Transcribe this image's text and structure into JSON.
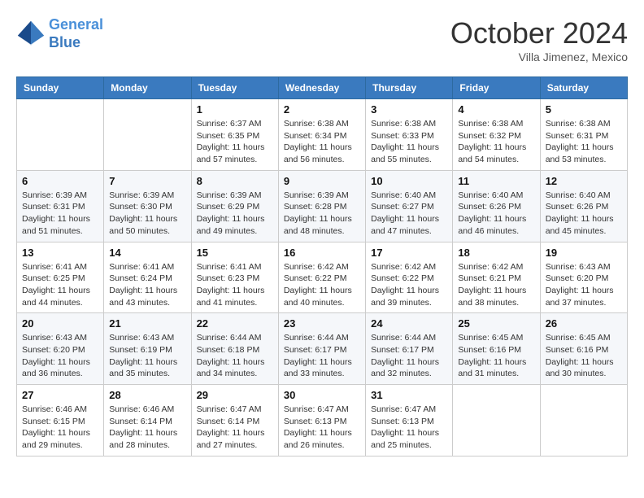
{
  "header": {
    "logo_line1": "General",
    "logo_line2": "Blue",
    "month": "October 2024",
    "location": "Villa Jimenez, Mexico"
  },
  "days_of_week": [
    "Sunday",
    "Monday",
    "Tuesday",
    "Wednesday",
    "Thursday",
    "Friday",
    "Saturday"
  ],
  "weeks": [
    [
      {
        "day": "",
        "content": ""
      },
      {
        "day": "",
        "content": ""
      },
      {
        "day": "1",
        "content": "Sunrise: 6:37 AM\nSunset: 6:35 PM\nDaylight: 11 hours and 57 minutes."
      },
      {
        "day": "2",
        "content": "Sunrise: 6:38 AM\nSunset: 6:34 PM\nDaylight: 11 hours and 56 minutes."
      },
      {
        "day": "3",
        "content": "Sunrise: 6:38 AM\nSunset: 6:33 PM\nDaylight: 11 hours and 55 minutes."
      },
      {
        "day": "4",
        "content": "Sunrise: 6:38 AM\nSunset: 6:32 PM\nDaylight: 11 hours and 54 minutes."
      },
      {
        "day": "5",
        "content": "Sunrise: 6:38 AM\nSunset: 6:31 PM\nDaylight: 11 hours and 53 minutes."
      }
    ],
    [
      {
        "day": "6",
        "content": "Sunrise: 6:39 AM\nSunset: 6:31 PM\nDaylight: 11 hours and 51 minutes."
      },
      {
        "day": "7",
        "content": "Sunrise: 6:39 AM\nSunset: 6:30 PM\nDaylight: 11 hours and 50 minutes."
      },
      {
        "day": "8",
        "content": "Sunrise: 6:39 AM\nSunset: 6:29 PM\nDaylight: 11 hours and 49 minutes."
      },
      {
        "day": "9",
        "content": "Sunrise: 6:39 AM\nSunset: 6:28 PM\nDaylight: 11 hours and 48 minutes."
      },
      {
        "day": "10",
        "content": "Sunrise: 6:40 AM\nSunset: 6:27 PM\nDaylight: 11 hours and 47 minutes."
      },
      {
        "day": "11",
        "content": "Sunrise: 6:40 AM\nSunset: 6:26 PM\nDaylight: 11 hours and 46 minutes."
      },
      {
        "day": "12",
        "content": "Sunrise: 6:40 AM\nSunset: 6:26 PM\nDaylight: 11 hours and 45 minutes."
      }
    ],
    [
      {
        "day": "13",
        "content": "Sunrise: 6:41 AM\nSunset: 6:25 PM\nDaylight: 11 hours and 44 minutes."
      },
      {
        "day": "14",
        "content": "Sunrise: 6:41 AM\nSunset: 6:24 PM\nDaylight: 11 hours and 43 minutes."
      },
      {
        "day": "15",
        "content": "Sunrise: 6:41 AM\nSunset: 6:23 PM\nDaylight: 11 hours and 41 minutes."
      },
      {
        "day": "16",
        "content": "Sunrise: 6:42 AM\nSunset: 6:22 PM\nDaylight: 11 hours and 40 minutes."
      },
      {
        "day": "17",
        "content": "Sunrise: 6:42 AM\nSunset: 6:22 PM\nDaylight: 11 hours and 39 minutes."
      },
      {
        "day": "18",
        "content": "Sunrise: 6:42 AM\nSunset: 6:21 PM\nDaylight: 11 hours and 38 minutes."
      },
      {
        "day": "19",
        "content": "Sunrise: 6:43 AM\nSunset: 6:20 PM\nDaylight: 11 hours and 37 minutes."
      }
    ],
    [
      {
        "day": "20",
        "content": "Sunrise: 6:43 AM\nSunset: 6:20 PM\nDaylight: 11 hours and 36 minutes."
      },
      {
        "day": "21",
        "content": "Sunrise: 6:43 AM\nSunset: 6:19 PM\nDaylight: 11 hours and 35 minutes."
      },
      {
        "day": "22",
        "content": "Sunrise: 6:44 AM\nSunset: 6:18 PM\nDaylight: 11 hours and 34 minutes."
      },
      {
        "day": "23",
        "content": "Sunrise: 6:44 AM\nSunset: 6:17 PM\nDaylight: 11 hours and 33 minutes."
      },
      {
        "day": "24",
        "content": "Sunrise: 6:44 AM\nSunset: 6:17 PM\nDaylight: 11 hours and 32 minutes."
      },
      {
        "day": "25",
        "content": "Sunrise: 6:45 AM\nSunset: 6:16 PM\nDaylight: 11 hours and 31 minutes."
      },
      {
        "day": "26",
        "content": "Sunrise: 6:45 AM\nSunset: 6:16 PM\nDaylight: 11 hours and 30 minutes."
      }
    ],
    [
      {
        "day": "27",
        "content": "Sunrise: 6:46 AM\nSunset: 6:15 PM\nDaylight: 11 hours and 29 minutes."
      },
      {
        "day": "28",
        "content": "Sunrise: 6:46 AM\nSunset: 6:14 PM\nDaylight: 11 hours and 28 minutes."
      },
      {
        "day": "29",
        "content": "Sunrise: 6:47 AM\nSunset: 6:14 PM\nDaylight: 11 hours and 27 minutes."
      },
      {
        "day": "30",
        "content": "Sunrise: 6:47 AM\nSunset: 6:13 PM\nDaylight: 11 hours and 26 minutes."
      },
      {
        "day": "31",
        "content": "Sunrise: 6:47 AM\nSunset: 6:13 PM\nDaylight: 11 hours and 25 minutes."
      },
      {
        "day": "",
        "content": ""
      },
      {
        "day": "",
        "content": ""
      }
    ]
  ]
}
